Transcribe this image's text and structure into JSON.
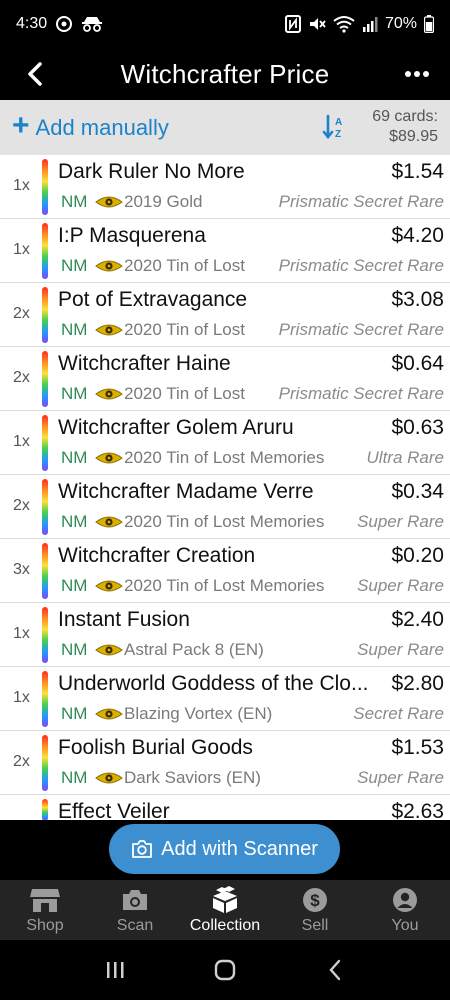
{
  "status": {
    "time": "4:30",
    "battery": "70%"
  },
  "appbar": {
    "title": "Witchcrafter Price"
  },
  "toolbar": {
    "add_manually": "Add manually",
    "card_count": "69 cards:",
    "total": "$89.95"
  },
  "cards": [
    {
      "qty": "1x",
      "name": "Dark Ruler No More",
      "price": "$1.54",
      "condition": "NM",
      "set": "2019 Gold",
      "rarity": "Prismatic Secret Rare"
    },
    {
      "qty": "1x",
      "name": "I:P Masquerena",
      "price": "$4.20",
      "condition": "NM",
      "set": "2020 Tin of Lost",
      "rarity": "Prismatic Secret Rare"
    },
    {
      "qty": "2x",
      "name": "Pot of Extravagance",
      "price": "$3.08",
      "condition": "NM",
      "set": "2020 Tin of Lost",
      "rarity": "Prismatic Secret Rare"
    },
    {
      "qty": "2x",
      "name": "Witchcrafter Haine",
      "price": "$0.64",
      "condition": "NM",
      "set": "2020 Tin of Lost",
      "rarity": "Prismatic Secret Rare"
    },
    {
      "qty": "1x",
      "name": "Witchcrafter Golem Aruru",
      "price": "$0.63",
      "condition": "NM",
      "set": "2020 Tin of Lost Memories",
      "rarity": "Ultra Rare"
    },
    {
      "qty": "2x",
      "name": "Witchcrafter Madame Verre",
      "price": "$0.34",
      "condition": "NM",
      "set": "2020 Tin of Lost Memories",
      "rarity": "Super Rare"
    },
    {
      "qty": "3x",
      "name": "Witchcrafter Creation",
      "price": "$0.20",
      "condition": "NM",
      "set": "2020 Tin of Lost Memories",
      "rarity": "Super Rare"
    },
    {
      "qty": "1x",
      "name": "Instant Fusion",
      "price": "$2.40",
      "condition": "NM",
      "set": "Astral Pack 8 (EN)",
      "rarity": "Super Rare"
    },
    {
      "qty": "1x",
      "name": "Underworld Goddess of the Clo...",
      "price": "$2.80",
      "condition": "NM",
      "set": "Blazing Vortex (EN)",
      "rarity": "Secret Rare"
    },
    {
      "qty": "2x",
      "name": "Foolish Burial Goods",
      "price": "$1.53",
      "condition": "NM",
      "set": "Dark Saviors (EN)",
      "rarity": "Super Rare"
    },
    {
      "qty": "",
      "name": "Effect Veiler",
      "price": "$2.63",
      "condition": "",
      "set": "",
      "rarity": ""
    }
  ],
  "scanner_button": "Add with Scanner",
  "nav": {
    "shop": "Shop",
    "scan": "Scan",
    "collection": "Collection",
    "sell": "Sell",
    "you": "You"
  },
  "colors": {
    "accent": "#1b83c9",
    "scanner": "#3d8fd0",
    "condition": "#2e8b57",
    "nav_bg": "#242424"
  },
  "icons": {
    "back": "back-arrow-icon",
    "more": "more-dots-icon",
    "sort": "sort-az-icon",
    "eye": "millennium-eye-icon",
    "camera": "camera-icon"
  }
}
